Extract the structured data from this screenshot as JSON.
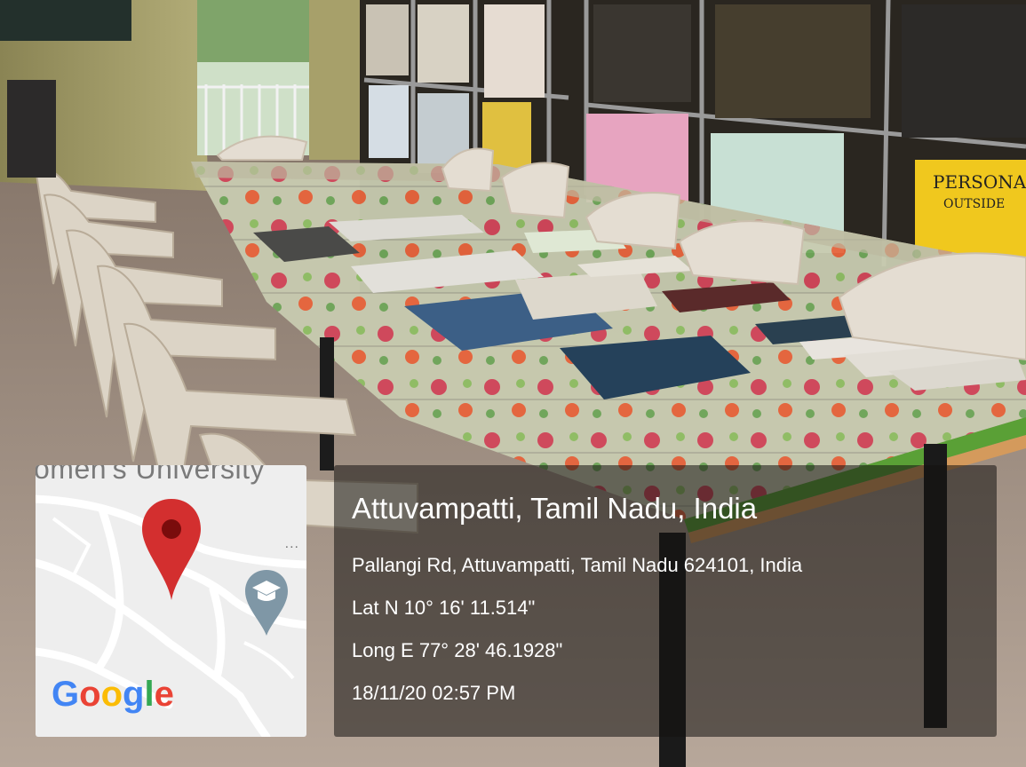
{
  "map": {
    "label_text": "omen's University",
    "more_text": "...",
    "logo_text": "Google",
    "logo_colors": [
      "#4285F4",
      "#EA4335",
      "#FBBC05",
      "#4285F4",
      "#34A853",
      "#EA4335"
    ],
    "pin_icon": "location-pin-icon",
    "place_icon": "graduation-cap-icon"
  },
  "location": {
    "title": "Attuvampatti, Tamil Nadu, India",
    "address": "Pallangi Rd, Attuvampatti, Tamil Nadu 624101, India",
    "latitude": "Lat N 10° 16' 11.514\"",
    "longitude": "Long E 77° 28' 46.1928\"",
    "timestamp": "18/11/20 02:57 PM"
  },
  "photo": {
    "poster_text": "PERSONA",
    "poster_subtext": "OUTSIDE"
  }
}
